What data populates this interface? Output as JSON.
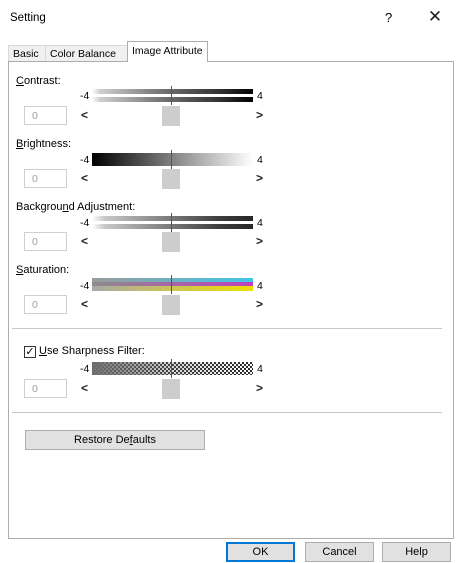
{
  "window": {
    "title": "Setting",
    "help_glyph": "?",
    "close_glyph": "✕"
  },
  "tabs": [
    {
      "label": "Basic",
      "active": false
    },
    {
      "label": "Color Balance",
      "active": false
    },
    {
      "label": "Image Attribute",
      "active": true
    }
  ],
  "sliders": [
    {
      "label_key": "C",
      "label_rest": "ontrast:",
      "min": "-4",
      "max": "4",
      "value": "0",
      "position": 0.5
    },
    {
      "label_key": "B",
      "label_rest": "rightness:",
      "min": "-4",
      "max": "4",
      "value": "0",
      "position": 0.5
    },
    {
      "label_pre": "Backgrou",
      "label_key": "n",
      "label_rest": "d Adjustment:",
      "min": "-4",
      "max": "4",
      "value": "0",
      "position": 0.5
    },
    {
      "label_key": "S",
      "label_rest": "aturation:",
      "min": "-4",
      "max": "4",
      "value": "0",
      "position": 0.5
    }
  ],
  "sharpness": {
    "checkbox_checked": true,
    "check_glyph": "✓",
    "label_key": "U",
    "label_rest": "se Sharpness Filter:",
    "min": "-4",
    "max": "4",
    "value": "0",
    "position": 0.5
  },
  "arrows": {
    "left": "<",
    "right": ">"
  },
  "restore_defaults": {
    "pre": "Restore De",
    "key": "f",
    "rest": "aults"
  },
  "buttons": {
    "ok": "OK",
    "cancel": "Cancel",
    "help": "Help"
  }
}
